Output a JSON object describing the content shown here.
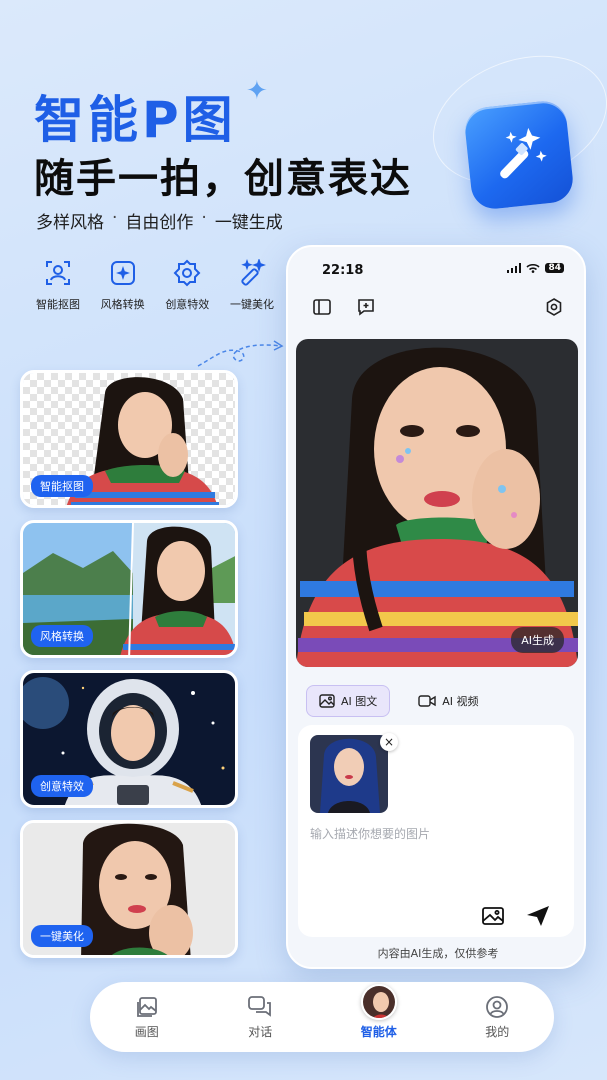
{
  "hero": {
    "title": "智能P图",
    "subtitle": "随手一拍，创意表达",
    "tags": [
      "多样风格",
      "自由创作",
      "一键生成"
    ],
    "tag_separator": "·"
  },
  "features": [
    {
      "label": "智能抠图",
      "icon": "portrait-cutout-icon"
    },
    {
      "label": "风格转换",
      "icon": "sparkle-frame-icon"
    },
    {
      "label": "创意特效",
      "icon": "gear-effect-icon"
    },
    {
      "label": "一键美化",
      "icon": "magic-wand-icon"
    }
  ],
  "samples": [
    {
      "badge": "智能抠图"
    },
    {
      "badge": "风格转换"
    },
    {
      "badge": "创意特效"
    },
    {
      "badge": "一键美化"
    }
  ],
  "phone": {
    "status_time": "22:18",
    "battery": "84",
    "ai_badge": "AI生成",
    "tabs": [
      {
        "label": "AI 图文",
        "icon": "image-icon",
        "active": true
      },
      {
        "label": "AI 视频",
        "icon": "video-icon",
        "active": false
      }
    ],
    "thumb_close": "×",
    "input_placeholder": "输入描述你想要的图片",
    "disclaimer": "内容由AI生成，仅供参考"
  },
  "nav": [
    {
      "label": "画图",
      "icon": "gallery-icon",
      "active": false
    },
    {
      "label": "对话",
      "icon": "chat-icon",
      "active": false
    },
    {
      "label": "智能体",
      "icon": "agent-avatar",
      "active": true
    },
    {
      "label": "我的",
      "icon": "profile-icon",
      "active": false
    }
  ],
  "colors": {
    "brand": "#1f5fe6",
    "badge": "#1f63f0",
    "background": "#d3e4fb"
  }
}
